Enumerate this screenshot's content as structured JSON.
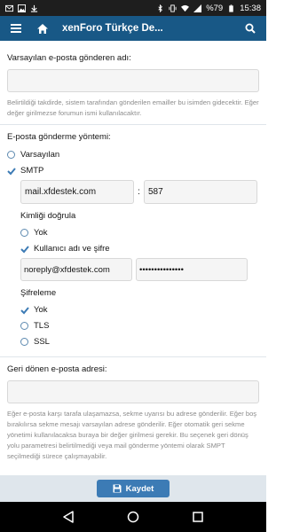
{
  "status_bar": {
    "battery": "%79",
    "time": "15:38"
  },
  "header": {
    "title": "xenForo Türkçe De..."
  },
  "sender_name": {
    "label": "Varsayılan e-posta gönderen adı:",
    "value": "",
    "explain": "Belirtildiği takdirde, sistem tarafından gönderilen emailler bu isimden gidecektir. Eğer değer girilmezse forumun ismi kullanılacaktır."
  },
  "method": {
    "label": "E-posta gönderme yöntemi:",
    "options": [
      "Varsayılan",
      "SMTP"
    ],
    "selected": "SMTP",
    "host": "mail.xfdestek.com",
    "colon": ":",
    "port": "587",
    "auth_label": "Kimliği doğrula",
    "auth_options": [
      "Yok",
      "Kullanıcı adı ve şifre"
    ],
    "auth_selected": "Kullanıcı adı ve şifre",
    "username": "noreply@xfdestek.com",
    "password": "•••••••••••••••",
    "enc_label": "Şifreleme",
    "enc_options": [
      "Yok",
      "TLS",
      "SSL"
    ],
    "enc_selected": "Yok"
  },
  "bounce": {
    "label": "Geri dönen e-posta adresi:",
    "value": "",
    "explain": "Eğer e-posta karşı tarafa ulaşamazsa, sekme uyarısı bu adrese gönderilir. Eğer boş bırakılırsa sekme mesajı varsayılan adrese gönderilir. Eğer otomatik geri sekme yönetimi kullanılacaksa buraya bir değer girilmesi gerekir. Bu seçenek geri dönüş yolu parametresi belirtilmediği veya mail gönderme yöntemi olarak SMPT seçilmediği sürece çalışmayabilir."
  },
  "save": {
    "label": "Kaydet"
  },
  "colors": {
    "header": "#185886",
    "accent": "#3c7bb5",
    "save_bar": "#dfe6ec"
  }
}
